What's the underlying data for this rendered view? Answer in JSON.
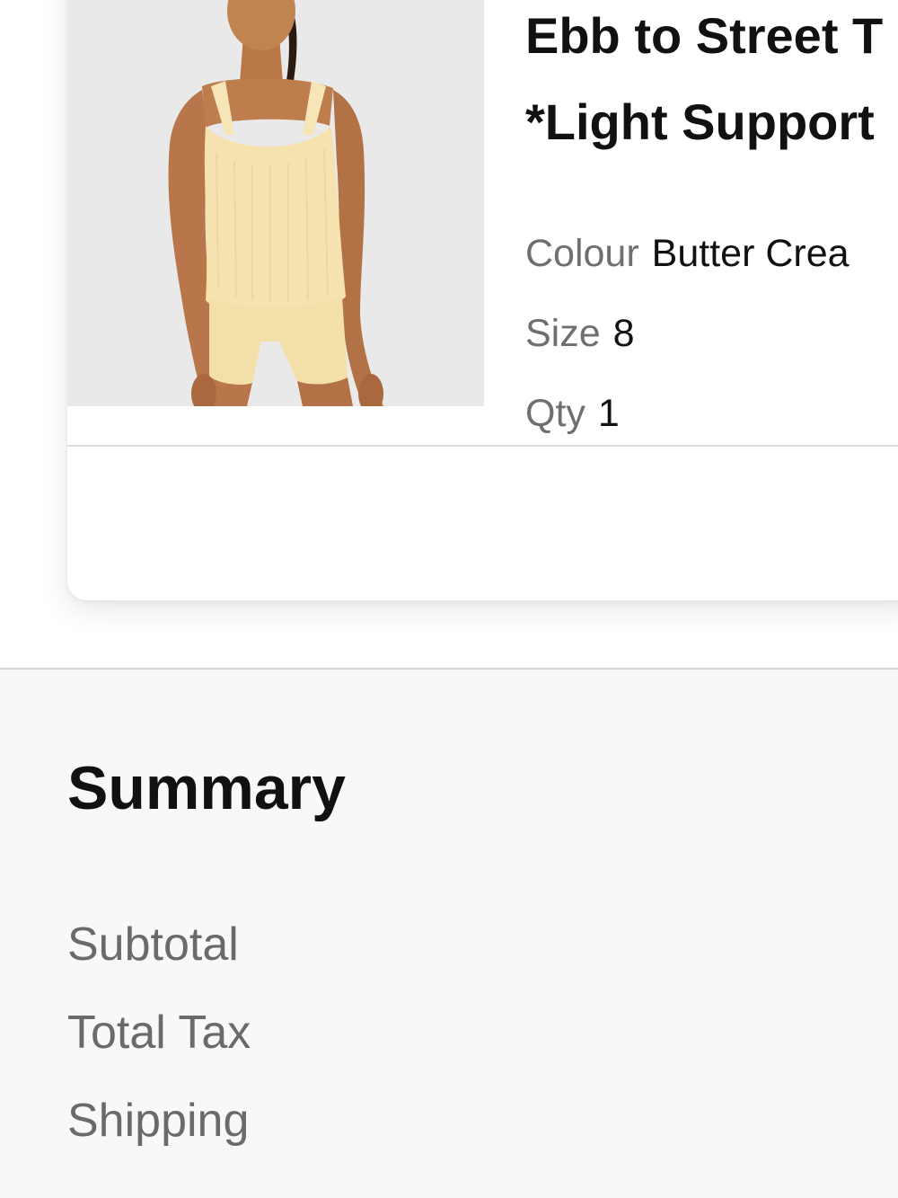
{
  "cart_item": {
    "product_name": "Ebb to Street T\n*Light Support",
    "image_alt": "model-wearing-butter-cream-tank-and-shorts",
    "colour_label": "Colour",
    "colour_value": "Butter Crea",
    "size_label": "Size",
    "size_value": "8",
    "qty_label": "Qty",
    "qty_value": "1"
  },
  "summary": {
    "title": "Summary",
    "rows": [
      {
        "label": "Subtotal"
      },
      {
        "label": "Total Tax"
      },
      {
        "label": "Shipping"
      }
    ]
  },
  "colors": {
    "product_tint": "#f4e3b4",
    "summary_background": "#f8f8f8",
    "muted_text": "#6f6f6f",
    "primary_text": "#111111"
  }
}
